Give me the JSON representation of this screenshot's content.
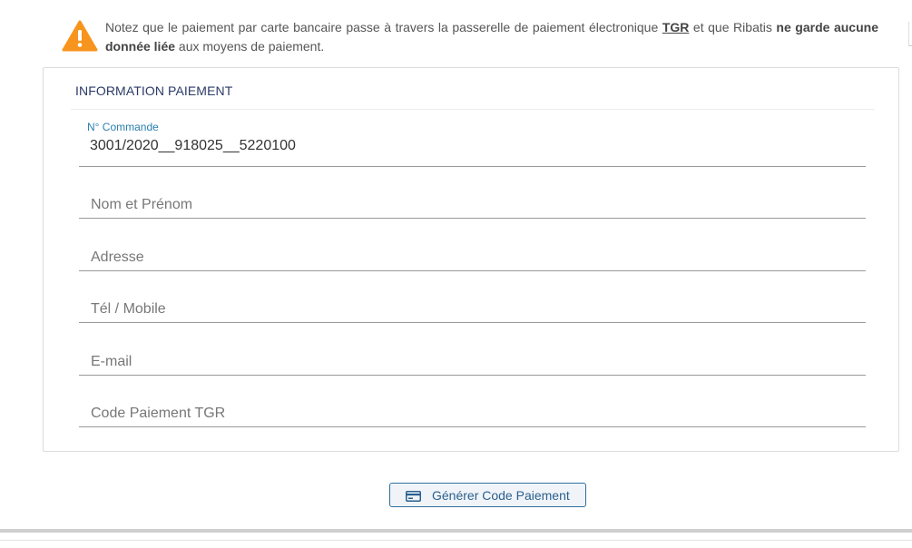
{
  "notice": {
    "text_1": "Notez que le paiement par carte bancaire passe à travers la passerelle de paiement électronique ",
    "gateway": "TGR",
    "text_2": " et que Ribatis ",
    "emphasis": "ne garde aucune donnée liée",
    "text_3": " aux moyens de paiement."
  },
  "card": {
    "title": "INFORMATION PAIEMENT",
    "fields": [
      {
        "label": "N° Commande",
        "value": "3001/2020__918025__5220100"
      },
      {
        "placeholder": "Nom et Prénom"
      },
      {
        "placeholder": "Adresse"
      },
      {
        "placeholder": "Tél / Mobile"
      },
      {
        "placeholder": "E-mail"
      },
      {
        "placeholder": "Code Paiement TGR"
      }
    ]
  },
  "button": {
    "label": "Générer Code Paiement",
    "icon": "credit-card-icon"
  },
  "colors": {
    "warning": "#f7941d",
    "accent": "#2a7fb0",
    "title": "#2b3a67"
  }
}
